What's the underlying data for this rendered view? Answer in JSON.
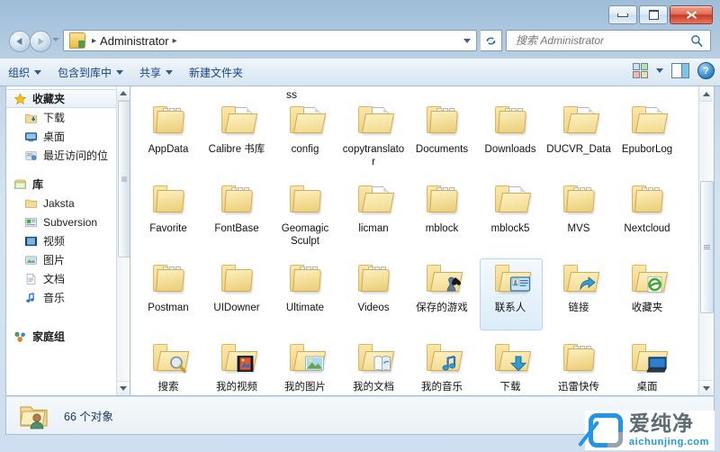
{
  "window": {
    "buttons": {
      "minimize": "—",
      "maximize": "▫",
      "close": "✕"
    }
  },
  "addressbar": {
    "back_icon": "back-arrow-icon",
    "forward_icon": "forward-arrow-icon",
    "crumb_icon": "user-folder-icon",
    "path": "Administrator",
    "sep": "▸",
    "refresh_icon": "↻",
    "dropdown_icon": "▾"
  },
  "search": {
    "placeholder": "搜索 Administrator",
    "value": "",
    "icon": "search-icon"
  },
  "commandbar": {
    "items": [
      {
        "label": "组织",
        "caret": true
      },
      {
        "label": "包含到库中",
        "caret": true
      },
      {
        "label": "共享",
        "caret": true
      },
      {
        "label": "新建文件夹",
        "caret": false
      }
    ],
    "views_icon": "views-grid-icon",
    "views_caret": "▾",
    "preview_pane_icon": "preview-pane-icon",
    "help_icon": "?"
  },
  "navpane": {
    "groups": [
      {
        "header": {
          "label": "收藏夹",
          "icon": "star-icon",
          "selected": true
        },
        "children": [
          {
            "label": "下载",
            "icon": "download-folder-icon"
          },
          {
            "label": "桌面",
            "icon": "desktop-icon"
          },
          {
            "label": "最近访问的位",
            "icon": "recent-places-icon"
          }
        ]
      },
      {
        "header": {
          "label": "库",
          "icon": "library-icon",
          "selected": false
        },
        "children": [
          {
            "label": "Jaksta",
            "icon": "folder-icon"
          },
          {
            "label": "Subversion",
            "icon": "subversion-icon"
          },
          {
            "label": "视频",
            "icon": "video-library-icon"
          },
          {
            "label": "图片",
            "icon": "pictures-library-icon"
          },
          {
            "label": "文档",
            "icon": "documents-library-icon"
          },
          {
            "label": "音乐",
            "icon": "music-library-icon"
          }
        ]
      },
      {
        "header": {
          "label": "家庭组",
          "icon": "homegroup-icon",
          "selected": false
        },
        "children": []
      }
    ]
  },
  "content": {
    "clipped_top_text": "ss",
    "items": [
      {
        "label": "AppData",
        "icon": "folder-files-icon",
        "selected": false
      },
      {
        "label": "Calibre 书库",
        "icon": "folder-doc-icon",
        "selected": false
      },
      {
        "label": "config",
        "icon": "folder-doc-icon",
        "selected": false
      },
      {
        "label": "copytranslator",
        "icon": "folder-doc-icon",
        "selected": false
      },
      {
        "label": "Documents",
        "icon": "folder-files-icon",
        "selected": false
      },
      {
        "label": "Downloads",
        "icon": "folder-files-icon",
        "selected": false
      },
      {
        "label": "DUCVR_Data",
        "icon": "folder-doc-icon",
        "selected": false
      },
      {
        "label": "EpuborLog",
        "icon": "folder-doc-icon",
        "selected": false
      },
      {
        "label": "Favorite",
        "icon": "folder-icon",
        "selected": false
      },
      {
        "label": "FontBase",
        "icon": "folder-files-icon",
        "selected": false
      },
      {
        "label": "Geomagic Sculpt",
        "icon": "folder-icon",
        "selected": false
      },
      {
        "label": "licman",
        "icon": "folder-doc-icon",
        "selected": false
      },
      {
        "label": "mblock",
        "icon": "folder-files-icon",
        "selected": false
      },
      {
        "label": "mblock5",
        "icon": "folder-doc-icon",
        "selected": false
      },
      {
        "label": "MVS",
        "icon": "folder-files-icon",
        "selected": false
      },
      {
        "label": "Nextcloud",
        "icon": "folder-files-icon",
        "selected": false
      },
      {
        "label": "Postman",
        "icon": "folder-files-icon",
        "selected": false
      },
      {
        "label": "UIDowner",
        "icon": "folder-icon",
        "selected": false
      },
      {
        "label": "Ultimate",
        "icon": "folder-files-icon",
        "selected": false
      },
      {
        "label": "Videos",
        "icon": "folder-files-icon",
        "selected": false
      },
      {
        "label": "保存的游戏",
        "icon": "saved-games-icon",
        "selected": false
      },
      {
        "label": "联系人",
        "icon": "contacts-icon",
        "selected": true
      },
      {
        "label": "链接",
        "icon": "links-icon",
        "selected": false
      },
      {
        "label": "收藏夹",
        "icon": "favorites-ie-icon",
        "selected": false
      },
      {
        "label": "搜索",
        "icon": "searches-icon",
        "selected": false
      },
      {
        "label": "我的视频",
        "icon": "my-videos-icon",
        "selected": false
      },
      {
        "label": "我的图片",
        "icon": "my-pictures-icon",
        "selected": false
      },
      {
        "label": "我的文档",
        "icon": "my-documents-icon",
        "selected": false
      },
      {
        "label": "我的音乐",
        "icon": "my-music-icon",
        "selected": false
      },
      {
        "label": "下载",
        "icon": "downloads-arrow-icon",
        "selected": false
      },
      {
        "label": "迅雷快传",
        "icon": "folder-files-icon",
        "selected": false
      },
      {
        "label": "桌面",
        "icon": "desktop-folder-icon",
        "selected": false,
        "highlighted": true
      }
    ]
  },
  "statusbar": {
    "icon": "user-folder-icon",
    "text": "66 个对象"
  },
  "watermark": {
    "cn": "爱纯净",
    "en": "aichunjing.com",
    "accent": "#2196e8"
  }
}
